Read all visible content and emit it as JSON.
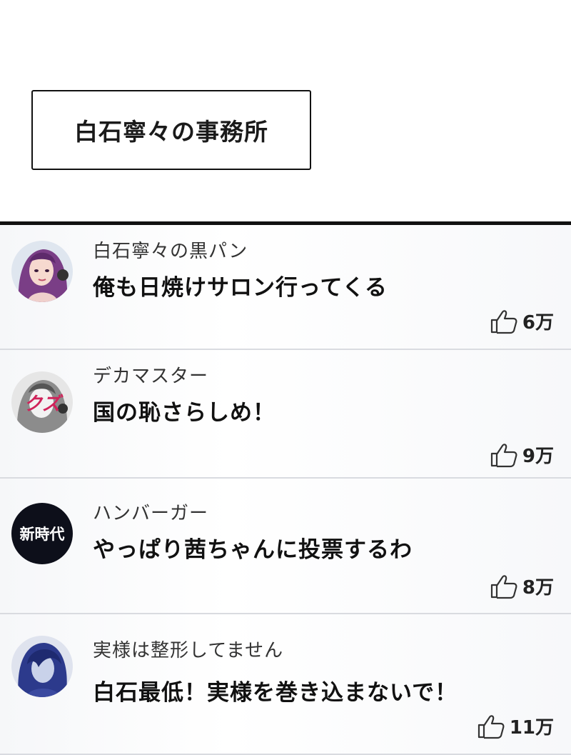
{
  "caption": {
    "text": "白石寧々の事務所"
  },
  "comments": [
    {
      "username": "白石寧々の黒パン",
      "message": "俺も日焼けサロン行ってくる",
      "likes": "6万",
      "avatar": "anime-woman-purple-hair-avatar"
    },
    {
      "username": "デカマスター",
      "message": "国の恥さらしめ！",
      "likes": "9万",
      "avatar": "graffiti-portrait-avatar",
      "avatar_text": "クズ"
    },
    {
      "username": "ハンバーガー",
      "message": "やっぱり茜ちゃんに投票するわ",
      "likes": "8万",
      "avatar": "text-badge-avatar",
      "avatar_text": "新時代"
    },
    {
      "username": "実様は整形してません",
      "message": "白石最低！実様を巻き込まないで！",
      "likes": "11万",
      "avatar": "anime-man-blue-hair-avatar"
    }
  ],
  "icons": {
    "like": "thumbs-up-icon"
  },
  "colors": {
    "border": "#111111",
    "divider": "#d9dbe0",
    "badge_bg": "#0d0f1a"
  }
}
